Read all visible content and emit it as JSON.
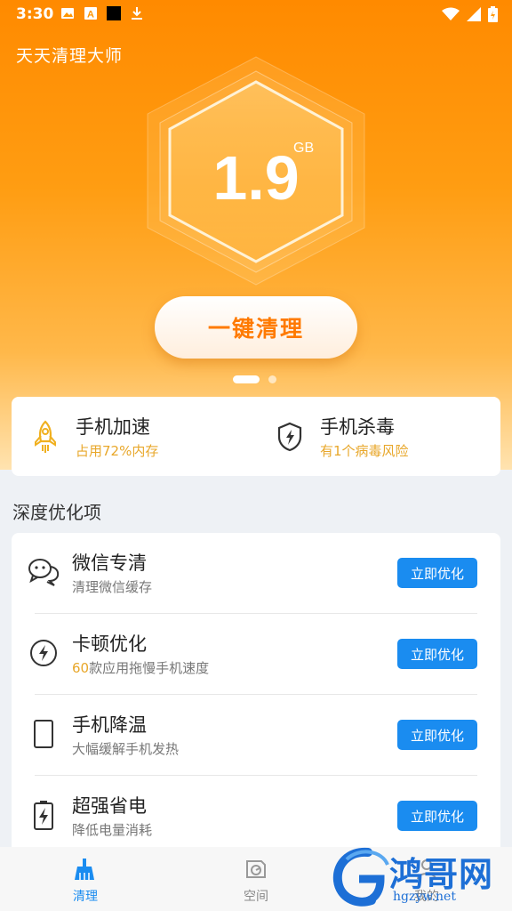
{
  "status_bar": {
    "time": "3:30",
    "left_icons": [
      "image-icon",
      "text-a-icon",
      "black-square-icon",
      "download-icon"
    ],
    "right_icons": [
      "wifi-icon",
      "signal-icon",
      "battery-icon"
    ]
  },
  "app": {
    "title": "天天清理大师"
  },
  "gauge": {
    "value": "1.9",
    "unit": "GB"
  },
  "clean_button": {
    "label": "一键清理"
  },
  "carousel": {
    "pages": 2,
    "active": 1
  },
  "quick_actions": [
    {
      "icon": "rocket-icon",
      "title": "手机加速",
      "subtitle": "占用72%内存"
    },
    {
      "icon": "shield-bolt-icon",
      "title": "手机杀毒",
      "subtitle": "有1个病毒风险"
    }
  ],
  "section": {
    "title": "深度优化项"
  },
  "optimize_items": [
    {
      "icon": "wechat-icon",
      "title": "微信专清",
      "subtitle": "清理微信缓存",
      "highlight": "",
      "button": "立即优化"
    },
    {
      "icon": "lightning-circle-icon",
      "title": "卡顿优化",
      "subtitle": "款应用拖慢手机速度",
      "highlight": "60",
      "button": "立即优化"
    },
    {
      "icon": "phone-outline-icon",
      "title": "手机降温",
      "subtitle": "大幅缓解手机发热",
      "highlight": "",
      "button": "立即优化"
    },
    {
      "icon": "battery-bolt-icon",
      "title": "超强省电",
      "subtitle": "降低电量消耗",
      "highlight": "",
      "button": "立即优化"
    }
  ],
  "bottom_nav": [
    {
      "icon": "broom-icon",
      "label": "清理",
      "active": true
    },
    {
      "icon": "disk-icon",
      "label": "空间",
      "active": false
    },
    {
      "icon": "user-icon",
      "label": "我的",
      "active": false
    }
  ],
  "watermark": {
    "text": "鸿哥网",
    "url": "hgzyw.net"
  },
  "colors": {
    "accent_orange": "#ff8a00",
    "button_blue": "#1a8cf0",
    "highlight_yellow": "#e8a72a"
  }
}
